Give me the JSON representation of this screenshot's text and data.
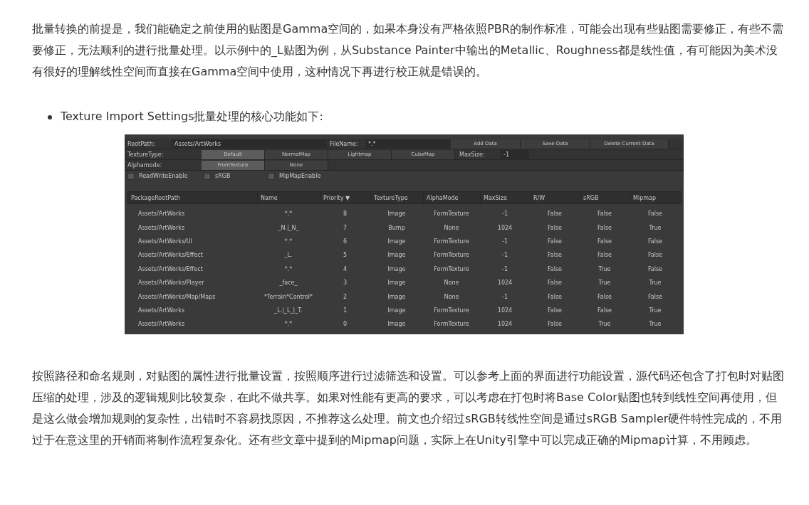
{
  "intro": "批量转换的前提是，我们能确定之前使用的贴图是Gamma空间的，如果本身没有严格依照PBR的制作标准，可能会出现有些贴图需要修正，有些不需要修正，无法顺利的进行批量处理。以示例中的_L贴图为例，从Substance Painter中输出的Metallic、Roughness都是线性值，有可能因为美术没有很好的理解线性空间而直接在Gamma空间中使用，这种情况下再进行校正就是错误的。",
  "bullet": "Texture Import Settings批量处理的核心功能如下:",
  "tool": {
    "root_path": {
      "label": "RootPath:",
      "value": "Assets/ArtWorks"
    },
    "file_name": {
      "label": "FileName:",
      "value": "*.*"
    },
    "buttons": [
      "Add Data",
      "Save Data",
      "Delete Current Data"
    ],
    "texture_type": {
      "label": "TextureType:",
      "options": [
        {
          "label": "Default",
          "selected": true
        },
        {
          "label": "NormalMap",
          "selected": false
        },
        {
          "label": "Lightmap",
          "selected": false
        },
        {
          "label": "CubeMap",
          "selected": false
        }
      ]
    },
    "max_size": {
      "label": "MaxSize:",
      "value": "-1"
    },
    "alpha_mode": {
      "label": "Alphamode:",
      "options": [
        {
          "label": "FromTexture",
          "selected": true
        },
        {
          "label": "None",
          "selected": false
        }
      ]
    },
    "checkboxes": [
      {
        "label": "ReadWriteEnable",
        "checked": false
      },
      {
        "label": "sRGB",
        "checked": false
      },
      {
        "label": "MipMapEnable",
        "checked": false
      }
    ],
    "table": {
      "columns": [
        "PackageRootPath",
        "Name",
        "Priority ▼",
        "TextureType",
        "AlphaMode",
        "MaxSize",
        "R/W",
        "sRGB",
        "Mipmap"
      ],
      "rows": [
        [
          "Assets/ArtWorks",
          "*.*",
          "8",
          "Image",
          "FormTexture",
          "-1",
          "False",
          "False",
          "False"
        ],
        [
          "Assets/ArtWorks",
          "_N.|_N_",
          "7",
          "Bump",
          "None",
          "1024",
          "False",
          "False",
          "True"
        ],
        [
          "Assets/ArtWorks/UI",
          "*.*",
          "6",
          "Image",
          "FormTexture",
          "-1",
          "False",
          "False",
          "False"
        ],
        [
          "Assets/ArtWorks/Effect",
          "_L.",
          "5",
          "Image",
          "FormTexture",
          "-1",
          "False",
          "False",
          "False"
        ],
        [
          "Assets/ArtWorks/Effect",
          "*.*",
          "4",
          "Image",
          "FormTexture",
          "-1",
          "False",
          "True",
          "False"
        ],
        [
          "Assets/ArtWorks/Player",
          "_face_",
          "3",
          "Image",
          "None",
          "1024",
          "False",
          "True",
          "True"
        ],
        [
          "Assets/ArtWorks/Map/Maps",
          "*Terrain*Control*",
          "2",
          "Image",
          "None",
          "-1",
          "False",
          "False",
          "False"
        ],
        [
          "Assets/ArtWorks",
          "_L.|_L_|_T.",
          "1",
          "Image",
          "FormTexture",
          "1024",
          "False",
          "False",
          "True"
        ],
        [
          "Assets/ArtWorks",
          "*.*",
          "0",
          "Image",
          "FormTexture",
          "1024",
          "False",
          "True",
          "True"
        ]
      ]
    }
  },
  "outro": "按照路径和命名规则，对贴图的属性进行批量设置，按照顺序进行过滤筛选和设置。可以参考上面的界面进行功能设置，源代码还包含了打包时对贴图压缩的处理，涉及的逻辑规则比较复杂，在此不做共享。如果对性能有更高的要求，可以考虑在打包时将Base Color贴图也转到线性空间再使用，但是这么做会增加规则的复杂性，出错时不容易找原因，不推荐这么处理。前文也介绍过sRGB转线性空间是通过sRGB Sampler硬件特性完成的，不用过于在意这里的开销而将制作流程复杂化。还有些文章中提到的Mipmap问题，实际上在Unity引擎中可以完成正确的Mipmap计算，不用顾虑。"
}
